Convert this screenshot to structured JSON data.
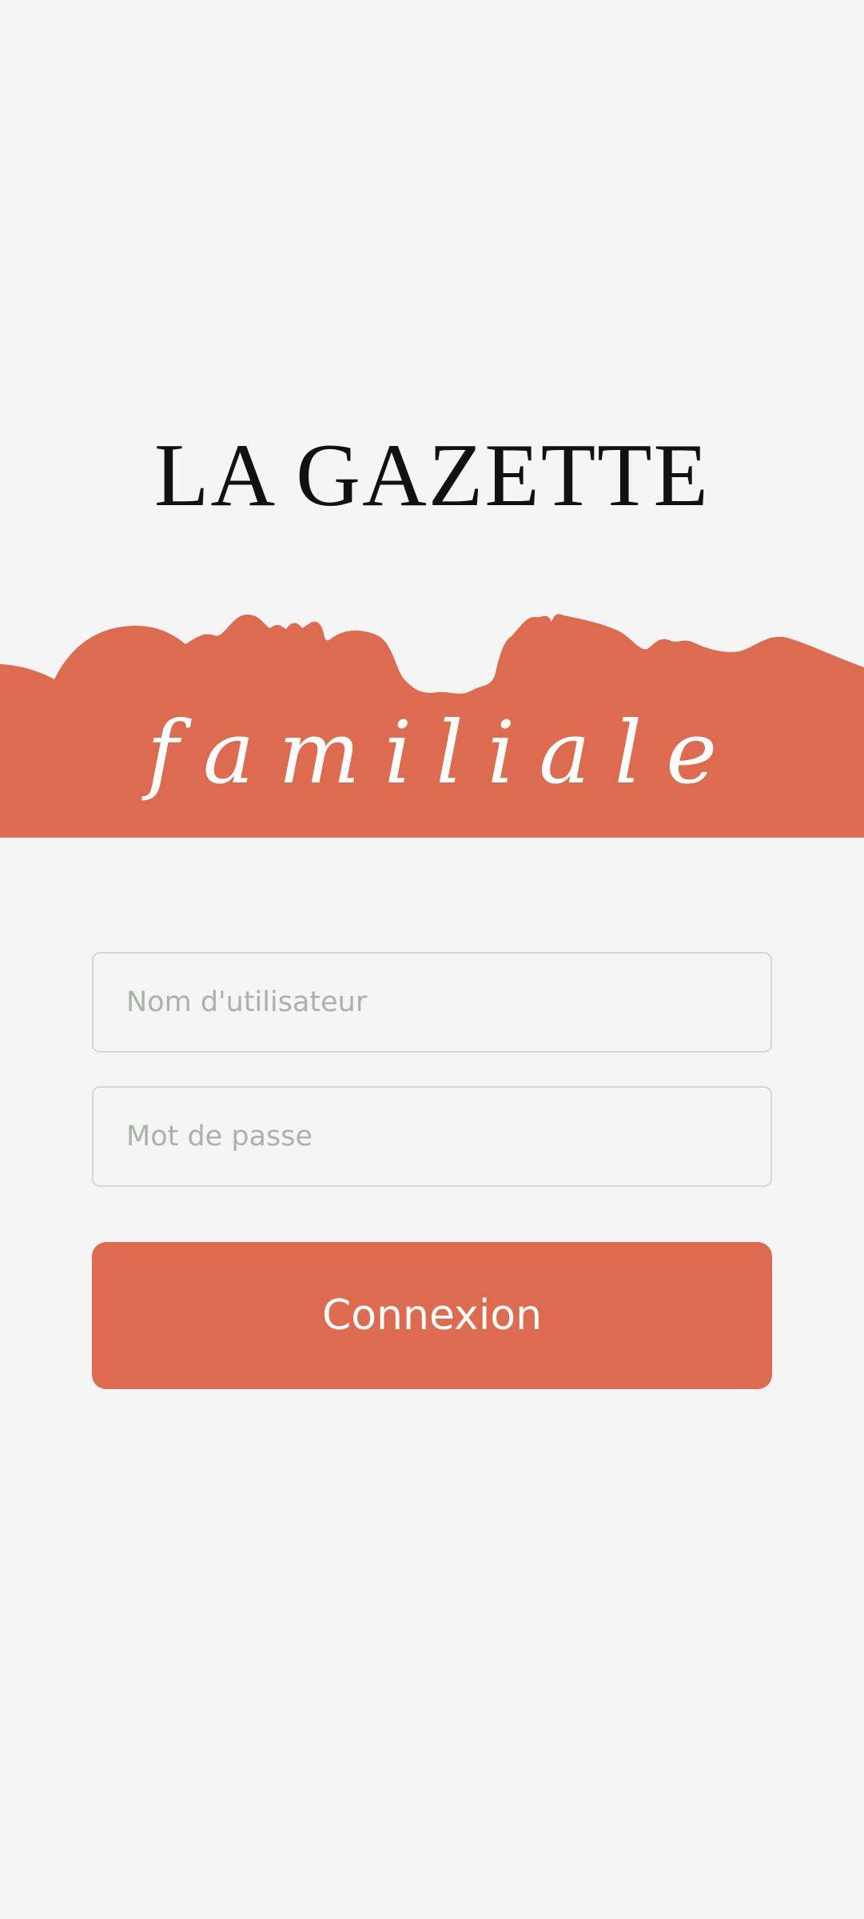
{
  "logo": {
    "title": "LA GAZETTE",
    "subtitle": "familiale"
  },
  "form": {
    "username_placeholder": "Nom d'utilisateur",
    "password_placeholder": "Mot de passe",
    "login_label": "Connexion"
  },
  "colors": {
    "accent": "#dd6b4f",
    "background": "#f4f5f4",
    "title_text": "#111111",
    "placeholder": "#adb0ad",
    "field_border": "#d6d7d6"
  }
}
